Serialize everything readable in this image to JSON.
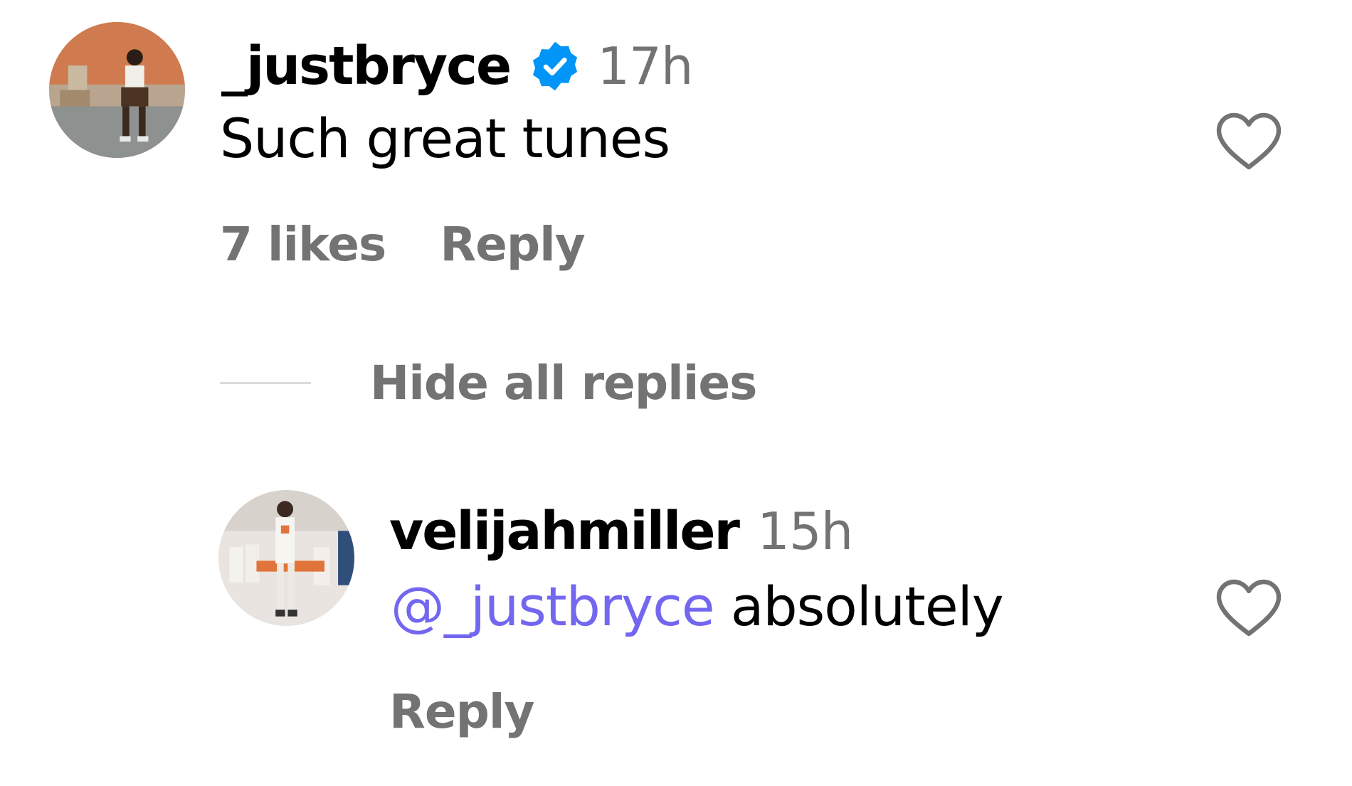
{
  "comment": {
    "username": "_justbryce",
    "verified": true,
    "time": "17h",
    "text": "Such great tunes",
    "likes": "7 likes",
    "reply_label": "Reply",
    "avatar": "profile-photo"
  },
  "replies_toggle": {
    "label": "Hide all replies"
  },
  "reply": {
    "username": "velijahmiller",
    "time": "15h",
    "mention": "@_justbryce",
    "text": " absolutely",
    "reply_label": "Reply",
    "avatar": "profile-photo"
  },
  "icons": {
    "verified": "verified-badge-icon",
    "like": "heart-outline-icon"
  },
  "colors": {
    "text": "#000000",
    "secondary": "#737373",
    "mention": "#7367f0",
    "verified": "#0095f6",
    "divider": "#dbdbdb"
  }
}
